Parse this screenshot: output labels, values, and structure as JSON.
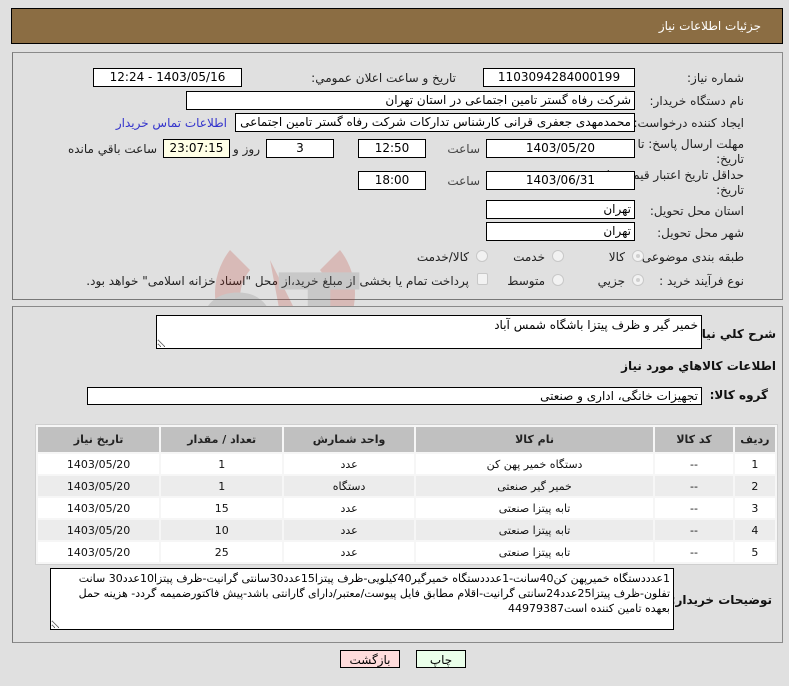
{
  "header": {
    "title": "جزئیات اطلاعات نیاز"
  },
  "form": {
    "need_number": {
      "label": "شماره نیاز:",
      "value": "1103094284000199"
    },
    "announce_datetime": {
      "label": "تاريخ و ساعت اعلان عمومي:",
      "value": "1403/05/16 - 12:24"
    },
    "buyer_org": {
      "label": "نام دستگاه خریدار:",
      "value": "شرکت رفاه گستر تامین اجتماعی در استان تهران"
    },
    "creator": {
      "label": "ایجاد کننده درخواست:",
      "value": "محمدمهدی جعفری قرانی کارشناس تدارکات شرکت رفاه گستر تامین اجتماعی"
    },
    "buyer_contact_link": "اطلاعات تماس خریدار",
    "response_deadline": {
      "label_line1": "مهلت ارسال پاسخ: تا",
      "label_line2": "تاریخ:",
      "date": "1403/05/20",
      "time_label": "ساعت",
      "time": "12:50",
      "days": "3",
      "days_label": "روز و",
      "remaining": "23:07:15",
      "remaining_label": "ساعت باقي مانده"
    },
    "price_validity": {
      "label_line1": "حداقل تاریخ اعتبار قیمت: تا",
      "label_line2": "تاریخ:",
      "date": "1403/06/31",
      "time_label": "ساعت",
      "time": "18:00"
    },
    "delivery_province": {
      "label": "استان محل تحویل:",
      "value": "تهران"
    },
    "delivery_city": {
      "label": "شهر محل تحویل:",
      "value": "تهران"
    },
    "category": {
      "label": "طبقه بندی موضوعی:",
      "options": [
        "کالا",
        "خدمت",
        "کالا/خدمت"
      ],
      "selected": "کالا"
    },
    "purchase_type": {
      "label": "نوع فرآیند خرید :",
      "options": [
        "جزیي",
        "متوسط"
      ],
      "selected": "جزیي",
      "treasury_checkbox_label": "پرداخت تمام یا بخشی از مبلغ خرید،از محل \"اسناد خزانه اسلامی\" خواهد بود.",
      "treasury_checked": false
    }
  },
  "details": {
    "description_label": "شرح کلي نياز:",
    "description_value": "خمیر گیر و ظرف پیتزا باشگاه شمس آباد",
    "items_section_title": "اطلاعات کالاهاي مورد نياز",
    "goods_group_label": "گروه کالا:",
    "goods_group_value": "تجهیزات خانگی، اداری و صنعتی",
    "table": {
      "headers": [
        "ردیف",
        "کد کالا",
        "نام کالا",
        "واحد شمارش",
        "تعداد / مقدار",
        "تاریخ نیاز"
      ],
      "rows": [
        {
          "row": "1",
          "code": "--",
          "name": "دستگاه خمیر پهن کن",
          "unit": "عدد",
          "qty": "1",
          "date": "1403/05/20"
        },
        {
          "row": "2",
          "code": "--",
          "name": "خمیر گیر صنعتی",
          "unit": "دستگاه",
          "qty": "1",
          "date": "1403/05/20"
        },
        {
          "row": "3",
          "code": "--",
          "name": "تابه پیتزا صنعتی",
          "unit": "عدد",
          "qty": "15",
          "date": "1403/05/20"
        },
        {
          "row": "4",
          "code": "--",
          "name": "تابه پیتزا صنعتی",
          "unit": "عدد",
          "qty": "10",
          "date": "1403/05/20"
        },
        {
          "row": "5",
          "code": "--",
          "name": "تابه پیتزا صنعتی",
          "unit": "عدد",
          "qty": "25",
          "date": "1403/05/20"
        }
      ]
    },
    "buyer_notes_label": "توضیحات خریدار:",
    "buyer_notes_value": "1عدددستگاه خمیرپهن کن40سانت-1عدددستگاه خمیرگیر40کیلویی-ظرف پیتزا15عدد30سانتی گرانیت-ظرف پیتزا10عدد30 سانت تفلون-ظرف پیتزا25عدد24سانتی گرانیت-اقلام مطابق فایل پیوست/معتبر/دارای گارانتی باشد-پیش فاکتورضمیمه گردد- هزینه حمل بعهده تامین کننده است44979387"
  },
  "buttons": {
    "print": "چاپ",
    "back": "بازگشت"
  },
  "colors": {
    "header_bg": "#8b6d43",
    "link": "#3333cc",
    "print_bg": "#eaffea",
    "back_bg": "#ffdcdc"
  },
  "watermark": "AriaTender.neT"
}
